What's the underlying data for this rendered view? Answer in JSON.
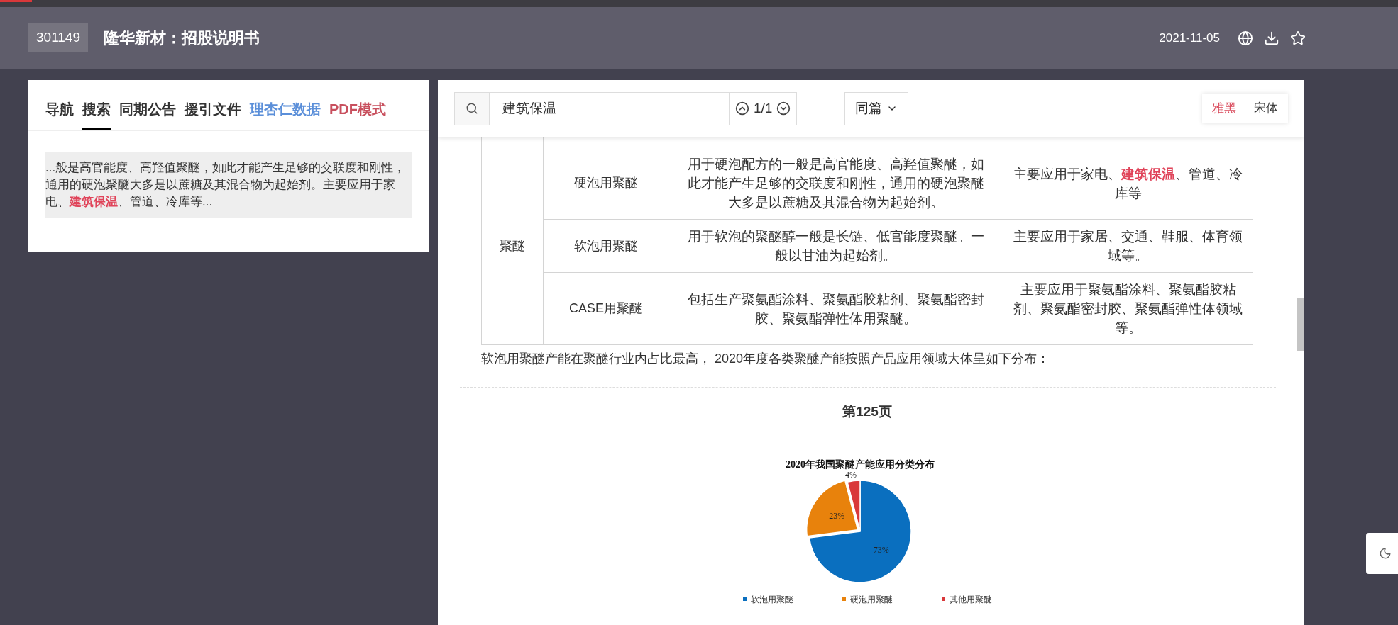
{
  "header": {
    "code": "301149",
    "title": "隆华新材：招股说明书",
    "date": "2021-11-05"
  },
  "tabs": [
    {
      "label": "导航",
      "selected": false,
      "color": "#333333"
    },
    {
      "label": "搜索",
      "selected": true,
      "color": "#333333"
    },
    {
      "label": "同期公告",
      "selected": false,
      "color": "#333333"
    },
    {
      "label": "援引文件",
      "selected": false,
      "color": "#333333"
    },
    {
      "label": "理杏仁数据",
      "selected": false,
      "color": "#5b8fd9"
    },
    {
      "label": "PDF模式",
      "selected": false,
      "color": "#c8505e"
    }
  ],
  "search_results": [
    {
      "text": "...般是高官能度、高羟值聚醚，如此才能产生足够的交联度和刚性，通用的硬泡聚醚大多是以蔗糖及其混合物为起始剂。主要应用于家电、**建筑保温**、管道、冷库等..."
    }
  ],
  "search": {
    "value": "建筑保温",
    "counter": "1/1",
    "scope": "同篇"
  },
  "fonts": [
    {
      "label": "雅黑",
      "selected": true
    },
    {
      "label": "宋体",
      "selected": false
    }
  ],
  "table": {
    "group": "聚醚",
    "rows": [
      {
        "type": "硬泡用聚醚",
        "description": "用于硬泡配方的一般是高官能度、高羟值聚醚，如此才能产生足够的交联度和刚性，通用的硬泡聚醚大多是以蔗糖及其混合物为起始剂。",
        "application": "主要应用于家电、**建筑保温**、管道、冷库等"
      },
      {
        "type": "软泡用聚醚",
        "description": "用于软泡的聚醚醇一般是长链、低官能度聚醚。一般以甘油为起始剂。",
        "application": "主要应用于家居、交通、鞋服、体育领域等。"
      },
      {
        "type": "CASE用聚醚",
        "description": "包括生产聚氨酯涂料、聚氨酯胶粘剂、聚氨酯密封胶、聚氨酯弹性体用聚醚。",
        "application": "主要应用于聚氨酯涂料、聚氨酯胶粘剂、聚氨酯密封胶、聚氨酯弹性体领域等。"
      }
    ]
  },
  "paragraph": "软泡用聚醚产能在聚醚行业内占比最高， 2020年度各类聚醚产能按照产品应用领域大体呈如下分布：",
  "page_label": "第125页",
  "chart": {
    "slices": [
      {
        "color": "#0a6fbf"
      },
      {
        "color": "#e8820c"
      },
      {
        "color": "#d9383a"
      }
    ],
    "chart_data": {
      "type": "pie",
      "title": "2020年我国聚醚产能应用分类分布",
      "categories": [
        "软泡用聚醚",
        "硬泡用聚醚",
        "其他用聚醚"
      ],
      "values": [
        73,
        23,
        4
      ],
      "value_labels": [
        "73%",
        "23%",
        "4%"
      ],
      "data_labels": true,
      "legend": "bottom"
    }
  }
}
